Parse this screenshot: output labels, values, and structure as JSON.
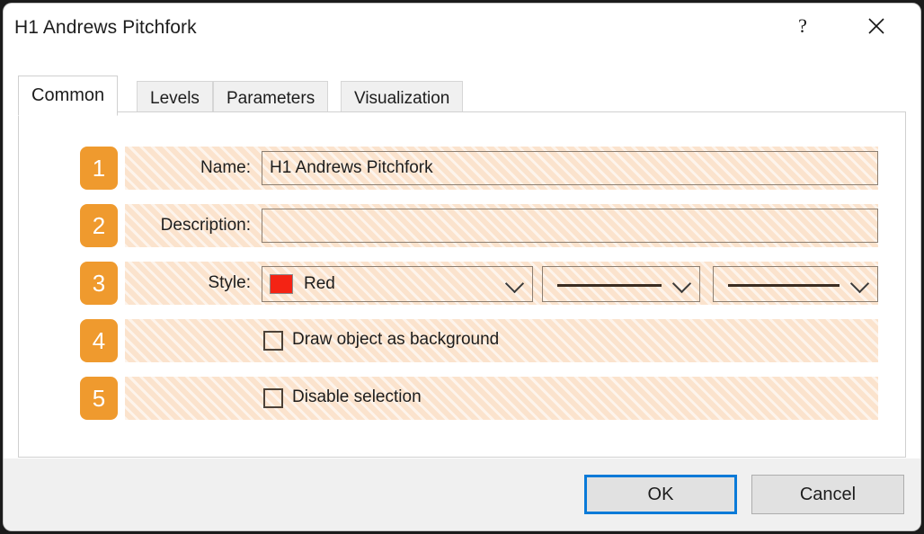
{
  "window": {
    "title": "H1 Andrews Pitchfork",
    "help_icon": "?",
    "close_icon": "✕"
  },
  "tabs": [
    {
      "label": "Common",
      "active": true
    },
    {
      "label": "Levels",
      "active": false
    },
    {
      "label": "Parameters",
      "active": false
    },
    {
      "label": "Visualization",
      "active": false
    }
  ],
  "form": {
    "rows": [
      {
        "badge": "1",
        "label": "Name:"
      },
      {
        "badge": "2",
        "label": "Description:"
      },
      {
        "badge": "3",
        "label": "Style:"
      },
      {
        "badge": "4",
        "label": ""
      },
      {
        "badge": "5",
        "label": ""
      }
    ],
    "name_field": {
      "value": "H1 Andrews Pitchfork",
      "placeholder": ""
    },
    "description_field": {
      "value": "",
      "placeholder": ""
    },
    "style": {
      "color_label": "Red",
      "color_value": "#f42314",
      "line_style_sample": "solid-line",
      "line_width_sample": "solid-line"
    },
    "checkboxes": [
      {
        "label": "Draw object as background",
        "checked": false
      },
      {
        "label": "Disable selection",
        "checked": false
      }
    ]
  },
  "footer": {
    "ok_label": "OK",
    "cancel_label": "Cancel"
  },
  "theme": {
    "accent_blue": "#0a7ad8",
    "badge_orange": "#ef9a2e",
    "highlight_peach": "#fbe3cd"
  }
}
